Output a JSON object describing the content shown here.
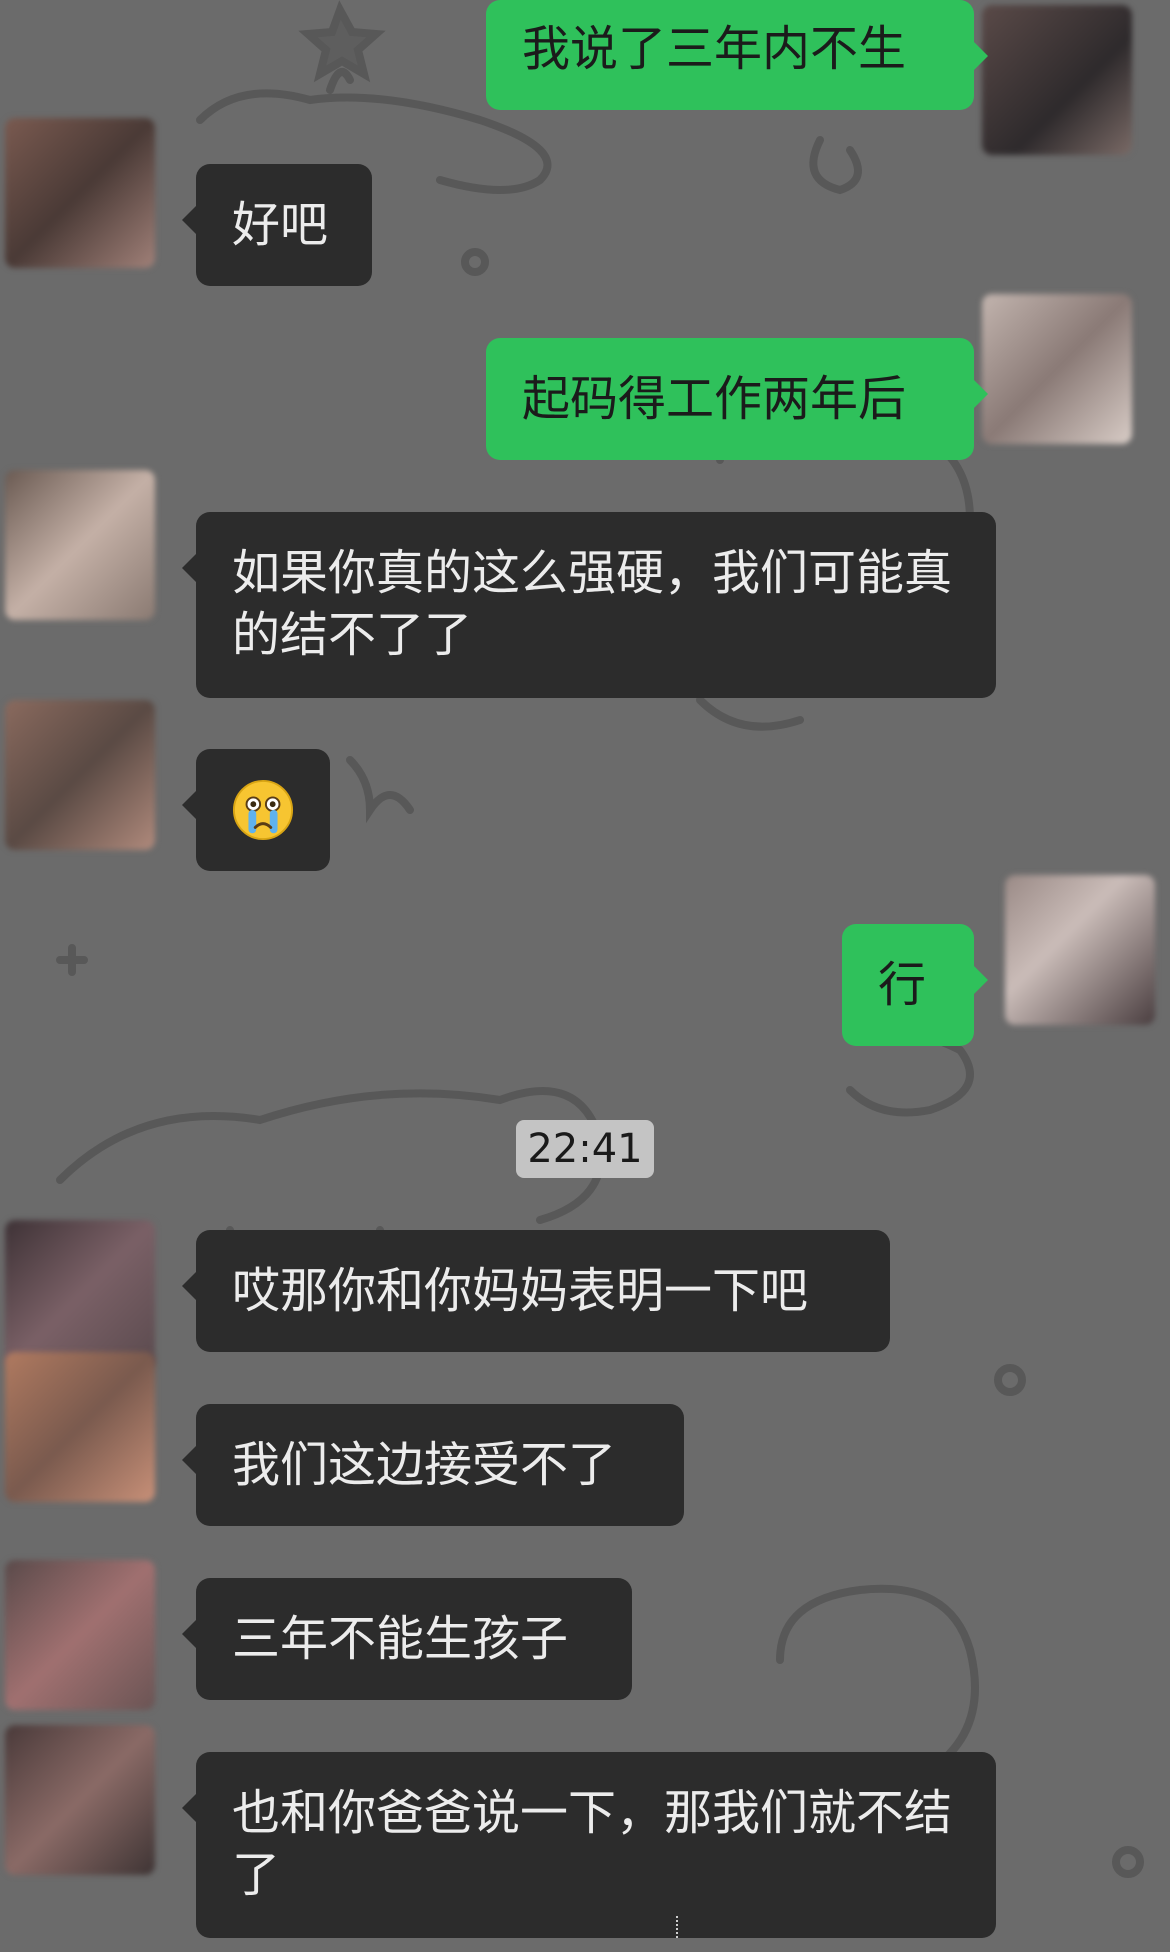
{
  "timestamp": "22:41",
  "messages": [
    {
      "side": "out",
      "text": "我说了三年内不生"
    },
    {
      "side": "in",
      "text": "好吧"
    },
    {
      "side": "out",
      "text": "起码得工作两年后"
    },
    {
      "side": "in",
      "text": "如果你真的这么强硬，我们可能真的结不了了"
    },
    {
      "side": "in",
      "text": "",
      "emoji": "crying-face-icon"
    },
    {
      "side": "out",
      "text": "行"
    },
    {
      "side": "in",
      "text": "哎那你和你妈妈表明一下吧"
    },
    {
      "side": "in",
      "text": "我们这边接受不了"
    },
    {
      "side": "in",
      "text": "三年不能生孩子"
    },
    {
      "side": "in",
      "text": "也和你爸爸说一下，那我们就不结了"
    }
  ],
  "colors": {
    "background": "#6b6b6b",
    "incoming_bubble": "#2c2c2c",
    "outgoing_bubble": "#2fc15b",
    "timestamp_pill": "#c4c4c4"
  }
}
